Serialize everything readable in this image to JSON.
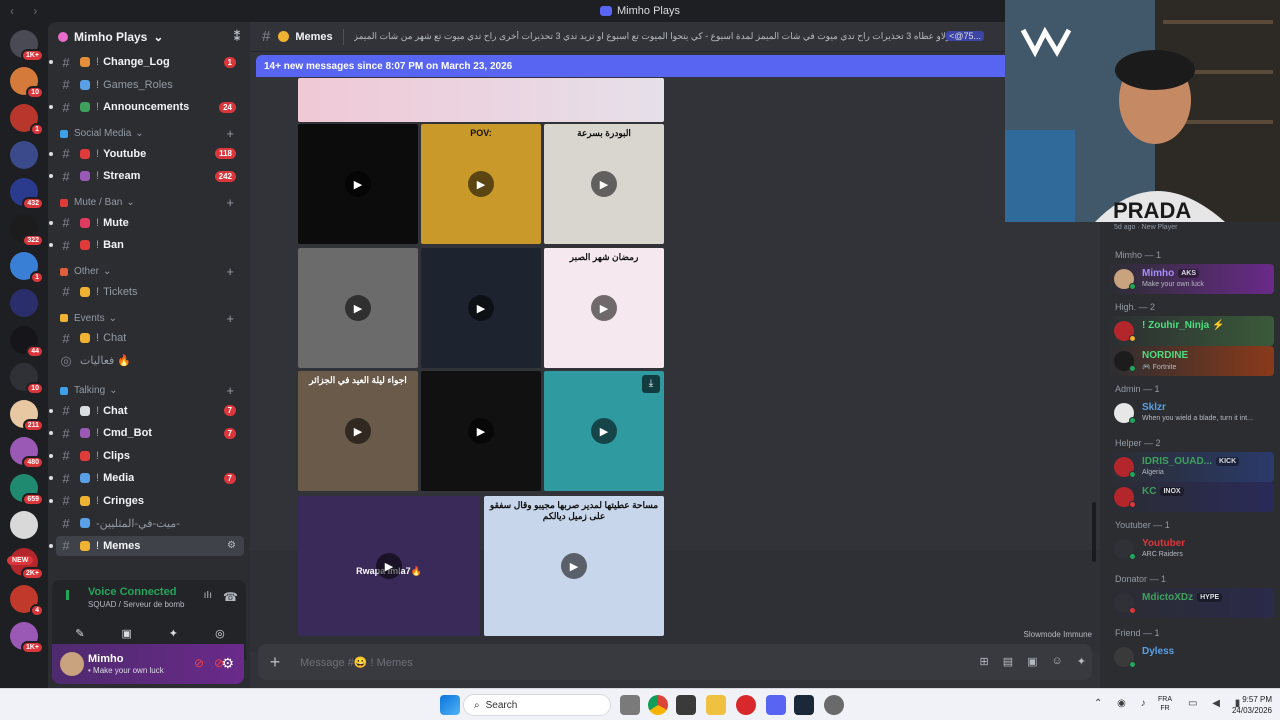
{
  "window": {
    "title": "Mimho Plays",
    "nav": "‹ ›"
  },
  "server": {
    "name": "Mimho Plays",
    "chevron": "⌄"
  },
  "server_rail": [
    {
      "badge": "1K+",
      "color": "#4a4a55"
    },
    {
      "badge": "10",
      "color": "#d47a3a"
    },
    {
      "badge": "1",
      "color": "#b8362b"
    },
    {
      "badge": "",
      "color": "#3b4a8a"
    },
    {
      "badge": "432",
      "color": "#2a3a8c"
    },
    {
      "badge": "322",
      "color": "#1c1c1c"
    },
    {
      "badge": "1",
      "color": "#3a7fd6"
    },
    {
      "badge": "",
      "color": "#2a2f6b"
    },
    {
      "badge": "44",
      "color": "#15151a"
    },
    {
      "badge": "10",
      "color": "#2f3136"
    },
    {
      "badge": "211",
      "color": "#e7c8a2"
    },
    {
      "badge": "480",
      "color": "#9b59b6"
    },
    {
      "badge": "659",
      "color": "#1f8a70"
    },
    {
      "badge": "",
      "color": "#d9d9d9"
    },
    {
      "badge": "2K+",
      "color": "#b3262b"
    },
    {
      "badge": "4",
      "color": "#c0392b"
    },
    {
      "badge": "1K+",
      "color": "#9b59b6"
    }
  ],
  "new_tag": "NEW",
  "channels": {
    "items": [
      {
        "type": "channel",
        "name": "Change_Log",
        "prefix": "!",
        "count": "1",
        "emo": "#e58f3a",
        "unread": true
      },
      {
        "type": "channel",
        "name": "Games_Roles",
        "prefix": "!",
        "count": "",
        "emo": "#5aa0e6",
        "unread": false
      },
      {
        "type": "channel",
        "name": "Announcements",
        "prefix": "!",
        "count": "24",
        "emo": "#3ea05c",
        "unread": true
      },
      {
        "type": "category",
        "name": "Social Media",
        "emo": "#3ea0e6"
      },
      {
        "type": "channel",
        "name": "Youtube",
        "prefix": "!",
        "count": "118",
        "emo": "#e03b3b",
        "unread": true
      },
      {
        "type": "channel",
        "name": "Stream",
        "prefix": "!",
        "count": "242",
        "emo": "#9b59b6",
        "unread": true
      },
      {
        "type": "category",
        "name": "Mute / Ban",
        "emo": "#e03b3b"
      },
      {
        "type": "channel",
        "name": "Mute",
        "prefix": "!",
        "count": "",
        "emo": "#e03b5f",
        "unread": true
      },
      {
        "type": "channel",
        "name": "Ban",
        "prefix": "!",
        "count": "",
        "emo": "#e03b3b",
        "unread": true
      },
      {
        "type": "category",
        "name": "Other",
        "emo": "#e05f3b"
      },
      {
        "type": "channel",
        "name": "Tickets",
        "prefix": "!",
        "count": "",
        "emo": "#f0b232",
        "unread": false
      },
      {
        "type": "category",
        "name": "Events",
        "emo": "#f0b232"
      },
      {
        "type": "channel",
        "name": "Chat",
        "prefix": "!",
        "count": "",
        "emo": "#f0b232",
        "unread": false
      },
      {
        "type": "voice",
        "name": "فعاليات 🔥",
        "prefix": "",
        "count": "",
        "emo": "",
        "unread": false
      },
      {
        "type": "category",
        "name": "Talking",
        "emo": "#3ea0e6"
      },
      {
        "type": "channel",
        "name": "Chat",
        "prefix": "!",
        "count": "7",
        "emo": "#dbdee1",
        "unread": true
      },
      {
        "type": "channel",
        "name": "Cmd_Bot",
        "prefix": "!",
        "count": "7",
        "emo": "#9b59b6",
        "unread": true
      },
      {
        "type": "channel",
        "name": "Clips",
        "prefix": "!",
        "count": "",
        "emo": "#e03b3b",
        "unread": true
      },
      {
        "type": "channel",
        "name": "Media",
        "prefix": "!",
        "count": "7",
        "emo": "#5aa0e6",
        "unread": true
      },
      {
        "type": "channel",
        "name": "Cringes",
        "prefix": "!",
        "count": "",
        "emo": "#f0b232",
        "unread": true
      },
      {
        "type": "channel",
        "name": "-ميت-في-المثليين-",
        "prefix": "",
        "count": "",
        "emo": "#5aa0e6",
        "unread": false
      },
      {
        "type": "channel",
        "name": "Memes",
        "prefix": "!",
        "count": "",
        "emo": "#f0b232",
        "unread": true,
        "active": true
      }
    ]
  },
  "voice": {
    "status": "Voice Connected",
    "detail": "SQUAD / Serveur de bomb",
    "buttons": [
      "✎",
      "▣",
      "✦",
      "◎"
    ]
  },
  "user": {
    "name": "Mimho",
    "status": "• Make your own luck"
  },
  "header": {
    "channel": "Memes",
    "topic": "ديرو عقوبات - تمدو 3 تحذيرات او وينا ولاو عطاه 3 تحذيرات راح تدي ميوت في شات الميمز لمدة اسبوع - كي يتحوا الميوت تع اسبوع او تزيد تدي 3 تحذيرات أخرى راح تدي ميوت تع شهر من شات الميمز",
    "mention": "<@75..."
  },
  "new_messages": "14+ new messages since 8:07 PM on March 23, 2026",
  "media_tiles": [
    {
      "caption": "",
      "bg": "#0c0c0c"
    },
    {
      "caption": "POV:",
      "bg": "#c99a2a"
    },
    {
      "caption": "البودرة بسرعة",
      "bg": "#d9d6d0"
    },
    {
      "caption": "",
      "bg": "#6b6b6b"
    },
    {
      "caption": "",
      "bg": "#1d2430"
    },
    {
      "caption": "رمضان شهر الصبر",
      "bg": "#f5e9ef"
    },
    {
      "caption": "اجواء ليلة العيد في الجزائر",
      "bg": "#6a5a4a"
    },
    {
      "caption": "",
      "bg": "#111"
    },
    {
      "caption": "",
      "bg": "#2f9aa0"
    },
    {
      "caption": "Rwapa lmla7🔥",
      "bg": "#3a2a5a"
    },
    {
      "caption": "مساحة عطيتها لمدير صربها مجيبو وقال سفقو على زميل ديالكم",
      "bg": "#c7d6ea"
    }
  ],
  "slowmode": "Slowmode Immune",
  "composer": {
    "placeholder": "Message #😀 ! Memes",
    "plus": "+"
  },
  "members": {
    "top_status": "5d ago · New Player",
    "groups": [
      {
        "label": "Mimho — 1",
        "members": [
          {
            "name": "Mimho",
            "tag": "AKS",
            "sub": "Make your own luck",
            "color": "#a78bfa",
            "av": "#c9a27e",
            "st": "#23a55a",
            "bg": "linear-gradient(90deg,#2b2d31,#6a2a8a)"
          }
        ]
      },
      {
        "label": "High. — 2",
        "members": [
          {
            "name": "! Zouhir_Ninja ⚡",
            "tag": "",
            "sub": "",
            "color": "#4ade80",
            "av": "#b3262b",
            "st": "#f0b232",
            "bg": "linear-gradient(90deg,#2b2d31,#3a5a3a)"
          },
          {
            "name": "NORDINE",
            "tag": "",
            "sub": "🎮 Fortnite",
            "color": "#4ade80",
            "av": "#1c1c1c",
            "st": "#23a55a",
            "bg": "linear-gradient(90deg,#2b2d31,#8a3a1a)"
          }
        ]
      },
      {
        "label": "Admin — 1",
        "members": [
          {
            "name": "Sklzr",
            "tag": "",
            "sub": "When you wield a blade, turn it int...",
            "color": "#5aa0e6",
            "av": "#e7e7e7",
            "st": "#23a55a",
            "bg": "transparent"
          }
        ]
      },
      {
        "label": "Helper — 2",
        "members": [
          {
            "name": "IDRIS_OUAD...",
            "tag": "KICK",
            "sub": "Algeria",
            "color": "#3ea05c",
            "av": "#b3262b",
            "st": "#23a55a",
            "bg": "linear-gradient(90deg,#2b2d31,#2a3a6a)"
          },
          {
            "name": "KC",
            "tag": "INOX",
            "sub": "",
            "color": "#3ea05c",
            "av": "#b3262b",
            "st": "#da373c",
            "bg": "linear-gradient(90deg,#2b2d31,#2a2a5a)"
          }
        ]
      },
      {
        "label": "Youtuber — 1",
        "members": [
          {
            "name": "Youtuber",
            "tag": "",
            "sub": "ARC Raiders",
            "color": "#da373c",
            "av": "#2f3136",
            "st": "#23a55a",
            "bg": "transparent"
          }
        ]
      },
      {
        "label": "Donator — 1",
        "members": [
          {
            "name": "MdictoXDz",
            "tag": "HYPE",
            "sub": "",
            "color": "#3ea05c",
            "av": "#2f3136",
            "st": "#da373c",
            "bg": "linear-gradient(90deg,#2b2d31,#2a2a4a)"
          }
        ]
      },
      {
        "label": "Friend — 1",
        "members": [
          {
            "name": "Dyless",
            "tag": "",
            "sub": "",
            "color": "#5aa0e6",
            "av": "#3a3a3a",
            "st": "#23a55a",
            "bg": "transparent"
          }
        ]
      }
    ]
  },
  "taskbar": {
    "search": "Search",
    "lang_top": "FRA",
    "lang_bottom": "FR",
    "time": "9:57 PM",
    "date": "24/03/2026"
  }
}
